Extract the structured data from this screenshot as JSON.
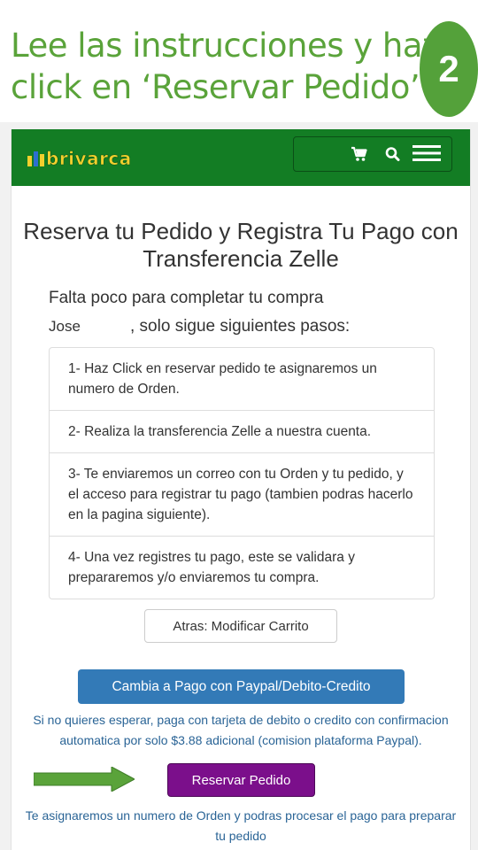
{
  "banner": {
    "line1": "Lee las instrucciones y haz",
    "line2": "click en ‘Reservar Pedido’",
    "step_number": "2"
  },
  "navbar": {
    "logo_text": "brivarca",
    "icons": [
      "cart-icon",
      "search-icon",
      "menu-icon"
    ]
  },
  "page": {
    "title": "Reserva tu Pedido y Registra Tu Pago con Transferencia Zelle",
    "intro_line1": "Falta poco para completar tu compra",
    "user_name": "Jose",
    "intro_line2": ", solo sigue siguientes pasos:",
    "steps": [
      "1- Haz Click en reservar pedido te asignaremos un numero de Orden.",
      "2- Realiza la transferencia Zelle a nuestra cuenta.",
      "3- Te enviaremos un correo con tu Orden y tu pedido, y el acceso para registrar tu pago (tambien podras hacerlo en la pagina siguiente).",
      "4- Una vez registres tu pago, este se validara y prepararemos y/o enviaremos tu compra."
    ],
    "back_button": "Atras: Modificar Carrito",
    "paypal_button": "Cambia a Pago con Paypal/Debito-Credito",
    "paypal_note": "Si no quieres esperar, paga con tarjeta de debito o credito con confirmacion automatica por solo $3.88 adicional (comision plataforma Paypal).",
    "reserve_button": "Reservar Pedido",
    "reserve_note": "Te asignaremos un numero de Orden y podras procesar el pago para preparar tu pedido"
  },
  "colors": {
    "banner_text": "#5aa33a",
    "navbar": "#137d24",
    "paypal_button": "#337ab7",
    "reserve_button": "#7b0f8b",
    "note_text": "#2a6496",
    "arrow": "#5aa33a"
  }
}
